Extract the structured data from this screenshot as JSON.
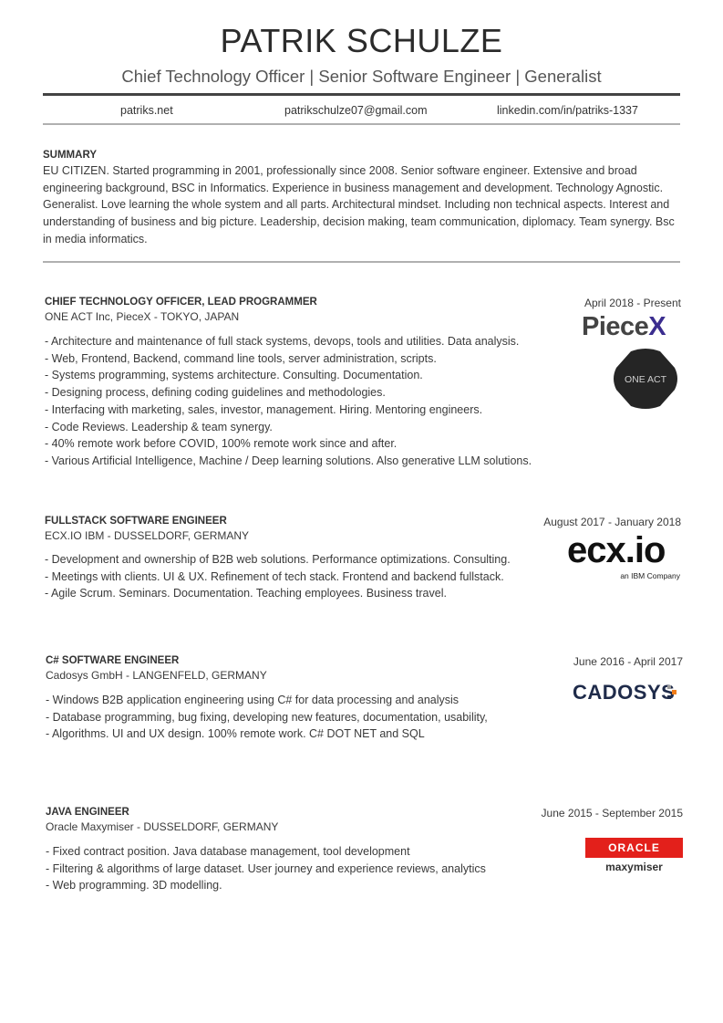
{
  "header": {
    "name": "PATRIK SCHULZE",
    "subtitle": "Chief Technology Officer | Senior Software Engineer | Generalist",
    "website": "patriks.net",
    "email": "patrikschulze07@gmail.com",
    "linkedin": "linkedin.com/in/patriks-1337"
  },
  "summary": {
    "title": "SUMMARY",
    "text": "EU CITIZEN. Started programming in 2001, professionally since 2008. Senior software engineer. Extensive and broad engineering background, BSC in Informatics. Experience in business management and development. Technology Agnostic. Generalist. Love learning the whole system and all parts. Architectural mindset. Including non technical aspects. Interest and understanding of business and big picture. Leadership, decision making, team communication, diplomacy. Team synergy. Bsc in media informatics."
  },
  "jobs": [
    {
      "title": "CHIEF TECHNOLOGY OFFICER, LEAD PROGRAMMER",
      "company": "ONE ACT Inc, PieceX - TOKYO, JAPAN",
      "date": "April 2018 - Present",
      "bullets": [
        "Architecture and maintenance of full stack systems, devops, tools and utilities. Data analysis.",
        "Web, Frontend, Backend, command line tools, server administration, scripts.",
        "Systems programming, systems architecture. Consulting. Documentation.",
        "Designing process, defining coding guidelines and methodologies.",
        "Interfacing with marketing, sales, investor, management. Hiring. Mentoring engineers.",
        "Code Reviews. Leadership & team synergy.",
        "40% remote work before COVID, 100% remote work since and after.",
        "Various Artificial Intelligence, Machine / Deep learning solutions. Also generative LLM solutions."
      ],
      "logos": [
        {
          "main": "Piece",
          "accent": "X",
          "accent_color": "#3b2d8f"
        },
        {
          "text": "ONE ACT"
        }
      ]
    },
    {
      "title": "FULLSTACK SOFTWARE ENGINEER",
      "company": "ECX.IO IBM - DUSSELDORF, GERMANY",
      "date": "August 2017 - January 2018",
      "bullets": [
        "Development and ownership of B2B web solutions. Performance optimizations. Consulting.",
        "Meetings with clients. UI & UX. Refinement of tech stack. Frontend and backend fullstack.",
        "Agile Scrum. Seminars. Documentation. Teaching employees. Business travel."
      ],
      "logos": [
        {
          "main": "ecx.io",
          "sub": "an IBM Company"
        }
      ]
    },
    {
      "title": "C# SOFTWARE ENGINEER",
      "company": "Cadosys GmbH - LANGENFELD, GERMANY",
      "date": "June 2016 - April 2017",
      "bullets": [
        "Windows B2B  application engineering using C# for data processing and analysis",
        "Database programming, bug fixing, developing new features, documentation, usability,",
        "Algorithms. UI and UX design. 100% remote work. C# DOT NET and SQL"
      ],
      "logos": [
        {
          "main": "CADOSYS",
          "color": "#1f2b4a",
          "accent_color": "#f07d1a"
        }
      ]
    },
    {
      "title": "JAVA ENGINEER",
      "company": "Oracle Maxymiser - DUSSELDORF, GERMANY",
      "date": "June 2015 - September 2015",
      "bullets": [
        "Fixed contract position. Java database management, tool development",
        "Filtering & algorithms of large dataset. User journey and experience reviews, analytics",
        "Web programming. 3D modelling."
      ],
      "logos": [
        {
          "main": "ORACLE",
          "sub": "maxymiser",
          "color": "#e3201b"
        }
      ]
    }
  ]
}
